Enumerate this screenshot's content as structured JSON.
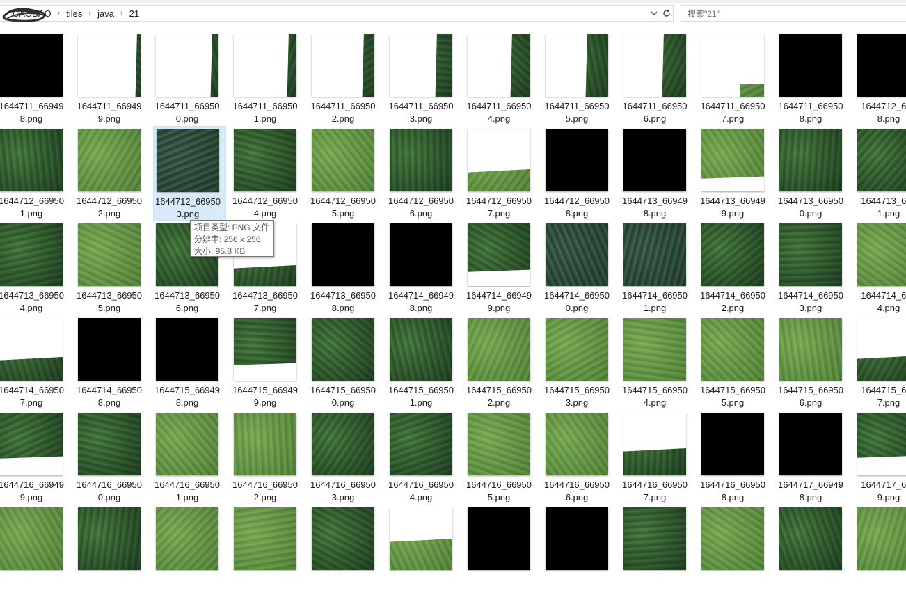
{
  "address_bar": {
    "breadcrumbs": [
      "CAOBAO",
      "tiles",
      "java",
      "21"
    ]
  },
  "search": {
    "placeholder": "搜索\"21\""
  },
  "tooltip": {
    "type": "项目类型: PNG 文件",
    "resolution": "分辨率: 256 x 256",
    "size": "大小: 95.8 KB"
  },
  "files": [
    {
      "line1": "1644711_66949",
      "line2": "8.png",
      "kind": "black"
    },
    {
      "line1": "1644711_66949",
      "line2": "9.png",
      "kind": "wr",
      "cover": 0.94,
      "tone": "forest"
    },
    {
      "line1": "1644711_66950",
      "line2": "0.png",
      "kind": "wr",
      "cover": 0.9,
      "tone": "forest"
    },
    {
      "line1": "1644711_66950",
      "line2": "1.png",
      "kind": "wr",
      "cover": 0.88,
      "tone": "forest"
    },
    {
      "line1": "1644711_66950",
      "line2": "2.png",
      "kind": "wr",
      "cover": 0.83,
      "tone": "forest"
    },
    {
      "line1": "1644711_66950",
      "line2": "3.png",
      "kind": "wr",
      "cover": 0.76,
      "tone": "forest"
    },
    {
      "line1": "1644711_66950",
      "line2": "4.png",
      "kind": "wr",
      "cover": 0.71,
      "tone": "forest"
    },
    {
      "line1": "1644711_66950",
      "line2": "5.png",
      "kind": "wr",
      "cover": 0.67,
      "tone": "forest"
    },
    {
      "line1": "1644711_66950",
      "line2": "6.png",
      "kind": "wr",
      "cover": 0.64,
      "tone": "forest"
    },
    {
      "line1": "1644711_66950",
      "line2": "7.png",
      "kind": "corner",
      "tone": "field"
    },
    {
      "line1": "1644711_66950",
      "line2": "8.png",
      "kind": "black"
    },
    {
      "line1": "1644712_669",
      "line2": "8.png",
      "kind": "black"
    },
    {
      "line1": "1644712_66950",
      "line2": "1.png",
      "kind": "img",
      "tone": "forest"
    },
    {
      "line1": "1644712_66950",
      "line2": "2.png",
      "kind": "img",
      "tone": "field"
    },
    {
      "line1": "1644712_66950",
      "line2": "3.png",
      "kind": "img",
      "tone": "dark",
      "selected": true
    },
    {
      "line1": "1644712_66950",
      "line2": "4.png",
      "kind": "img",
      "tone": "forest"
    },
    {
      "line1": "1644712_66950",
      "line2": "5.png",
      "kind": "img",
      "tone": "field"
    },
    {
      "line1": "1644712_66950",
      "line2": "6.png",
      "kind": "img",
      "tone": "forest"
    },
    {
      "line1": "1644712_66950",
      "line2": "7.png",
      "kind": "wt",
      "cover": 0.7,
      "tone": "field"
    },
    {
      "line1": "1644712_66950",
      "line2": "8.png",
      "kind": "black"
    },
    {
      "line1": "1644713_66949",
      "line2": "8.png",
      "kind": "black"
    },
    {
      "line1": "1644713_66949",
      "line2": "9.png",
      "kind": "wb",
      "cover": 0.2,
      "tone": "field"
    },
    {
      "line1": "1644713_66950",
      "line2": "0.png",
      "kind": "img",
      "tone": "forest"
    },
    {
      "line1": "1644713_669",
      "line2": "1.png",
      "kind": "img",
      "tone": "forest"
    },
    {
      "line1": "1644713_66950",
      "line2": "4.png",
      "kind": "img",
      "tone": "forest"
    },
    {
      "line1": "1644713_66950",
      "line2": "5.png",
      "kind": "img",
      "tone": "field"
    },
    {
      "line1": "1644713_66950",
      "line2": "6.png",
      "kind": "img",
      "tone": "forest"
    },
    {
      "line1": "1644713_66950",
      "line2": "7.png",
      "kind": "wt",
      "cover": 0.72,
      "tone": "forest"
    },
    {
      "line1": "1644713_66950",
      "line2": "8.png",
      "kind": "black"
    },
    {
      "line1": "1644714_66949",
      "line2": "8.png",
      "kind": "black"
    },
    {
      "line1": "1644714_66949",
      "line2": "9.png",
      "kind": "wb",
      "cover": 0.22,
      "tone": "forest"
    },
    {
      "line1": "1644714_66950",
      "line2": "0.png",
      "kind": "img",
      "tone": "dark"
    },
    {
      "line1": "1644714_66950",
      "line2": "1.png",
      "kind": "img",
      "tone": "dark"
    },
    {
      "line1": "1644714_66950",
      "line2": "2.png",
      "kind": "img",
      "tone": "forest"
    },
    {
      "line1": "1644714_66950",
      "line2": "3.png",
      "kind": "img",
      "tone": "forest"
    },
    {
      "line1": "1644714_669",
      "line2": "4.png",
      "kind": "img",
      "tone": "field"
    },
    {
      "line1": "1644714_66950",
      "line2": "7.png",
      "kind": "wt",
      "cover": 0.68,
      "tone": "forest"
    },
    {
      "line1": "1644714_66950",
      "line2": "8.png",
      "kind": "black"
    },
    {
      "line1": "1644715_66949",
      "line2": "8.png",
      "kind": "black"
    },
    {
      "line1": "1644715_66949",
      "line2": "9.png",
      "kind": "wb",
      "cover": 0.25,
      "tone": "forest"
    },
    {
      "line1": "1644715_66950",
      "line2": "0.png",
      "kind": "img",
      "tone": "forest"
    },
    {
      "line1": "1644715_66950",
      "line2": "1.png",
      "kind": "img",
      "tone": "forest"
    },
    {
      "line1": "1644715_66950",
      "line2": "2.png",
      "kind": "img",
      "tone": "field"
    },
    {
      "line1": "1644715_66950",
      "line2": "3.png",
      "kind": "img",
      "tone": "field"
    },
    {
      "line1": "1644715_66950",
      "line2": "4.png",
      "kind": "img",
      "tone": "field"
    },
    {
      "line1": "1644715_66950",
      "line2": "5.png",
      "kind": "img",
      "tone": "field"
    },
    {
      "line1": "1644715_66950",
      "line2": "6.png",
      "kind": "img",
      "tone": "field"
    },
    {
      "line1": "1644715_669",
      "line2": "7.png",
      "kind": "wt",
      "cover": 0.65,
      "tone": "forest"
    },
    {
      "line1": "1644716_66949",
      "line2": "9.png",
      "kind": "wb",
      "cover": 0.27,
      "tone": "forest"
    },
    {
      "line1": "1644716_66950",
      "line2": "0.png",
      "kind": "img",
      "tone": "forest"
    },
    {
      "line1": "1644716_66950",
      "line2": "1.png",
      "kind": "img",
      "tone": "field"
    },
    {
      "line1": "1644716_66950",
      "line2": "2.png",
      "kind": "img",
      "tone": "field"
    },
    {
      "line1": "1644716_66950",
      "line2": "3.png",
      "kind": "img",
      "tone": "forest"
    },
    {
      "line1": "1644716_66950",
      "line2": "4.png",
      "kind": "img",
      "tone": "forest"
    },
    {
      "line1": "1644716_66950",
      "line2": "5.png",
      "kind": "img",
      "tone": "field"
    },
    {
      "line1": "1644716_66950",
      "line2": "6.png",
      "kind": "img",
      "tone": "field"
    },
    {
      "line1": "1644716_66950",
      "line2": "7.png",
      "kind": "wt",
      "cover": 0.62,
      "tone": "forest"
    },
    {
      "line1": "1644716_66950",
      "line2": "8.png",
      "kind": "black"
    },
    {
      "line1": "1644717_66949",
      "line2": "8.png",
      "kind": "black"
    },
    {
      "line1": "1644717_669",
      "line2": "9.png",
      "kind": "wb",
      "cover": 0.28,
      "tone": "forest"
    },
    {
      "line1": "",
      "line2": "",
      "kind": "img",
      "tone": "field"
    },
    {
      "line1": "",
      "line2": "",
      "kind": "img",
      "tone": "forest"
    },
    {
      "line1": "",
      "line2": "",
      "kind": "img",
      "tone": "field"
    },
    {
      "line1": "",
      "line2": "",
      "kind": "img",
      "tone": "field"
    },
    {
      "line1": "",
      "line2": "",
      "kind": "img",
      "tone": "forest"
    },
    {
      "line1": "",
      "line2": "",
      "kind": "wt",
      "cover": 0.55,
      "tone": "field"
    },
    {
      "line1": "",
      "line2": "",
      "kind": "black"
    },
    {
      "line1": "",
      "line2": "",
      "kind": "black"
    },
    {
      "line1": "",
      "line2": "",
      "kind": "img",
      "tone": "forest"
    },
    {
      "line1": "",
      "line2": "",
      "kind": "img",
      "tone": "field"
    },
    {
      "line1": "",
      "line2": "",
      "kind": "img",
      "tone": "forest"
    },
    {
      "line1": "",
      "line2": "",
      "kind": "img",
      "tone": "field"
    }
  ],
  "colors": {
    "selection": "#d9ebf9",
    "forest": "#4f6b4a",
    "field": "#6f8a5e",
    "dark": "#3c4f44"
  }
}
